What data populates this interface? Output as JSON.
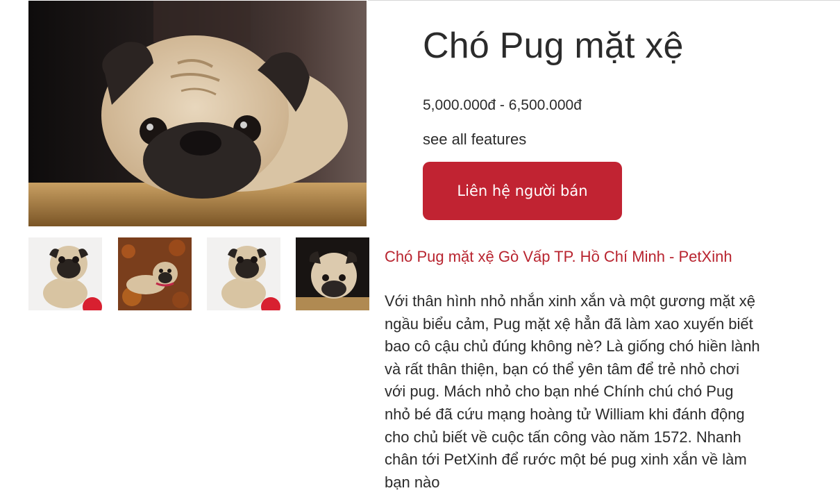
{
  "product": {
    "title": "Chó Pug mặt xệ",
    "price_range": "5,000.000đ - 6,500.000đ",
    "features_link": "see all features",
    "contact_button": "Liên hệ người bán"
  },
  "gallery": {
    "main_image": "pug-face-resting-on-table-photo",
    "thumbnails": [
      "pug-puppy-sitting-photo",
      "pug-puppy-on-leaves-photo",
      "pug-puppy-sitting-photo",
      "pug-face-resting-on-table-photo"
    ]
  },
  "description": {
    "heading": "Chó Pug mặt xệ Gò Vấp TP. Hồ Chí Minh - PetXinh",
    "body": "Với thân hình nhỏ nhắn xinh xắn và một gương mặt xệ ngầu biểu cảm, Pug mặt xệ hẳn đã làm xao xuyến biết bao cô cậu chủ đúng không nè? Là giống chó hiền lành và rất thân thiện, bạn có thể yên tâm để trẻ nhỏ chơi với pug. Mách nhỏ cho bạn nhé Chính chú chó Pug nhỏ bé đã cứu mạng hoàng tử William khi đánh động cho chủ biết về cuộc tấn công vào năm 1572. Nhanh chân tới PetXinh để rước một bé pug xinh xắn về làm bạn nào"
  },
  "colors": {
    "accent_red": "#c12332",
    "heading_red": "#b8242f",
    "text": "#2b2b2b"
  }
}
